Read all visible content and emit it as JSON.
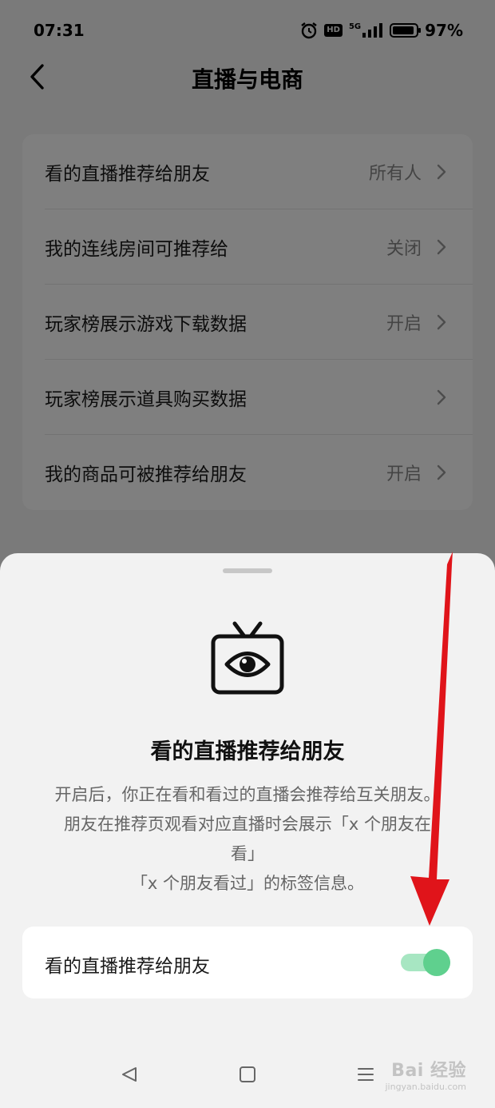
{
  "status_bar": {
    "time": "07:31",
    "hd_label": "HD",
    "network_label": "5G",
    "battery_percent": "97%"
  },
  "header": {
    "title": "直播与电商"
  },
  "settings": [
    {
      "label": "看的直播推荐给朋友",
      "value": "所有人"
    },
    {
      "label": "我的连线房间可推荐给",
      "value": "关闭"
    },
    {
      "label": "玩家榜展示游戏下载数据",
      "value": "开启"
    },
    {
      "label": "玩家榜展示道具购买数据",
      "value": ""
    },
    {
      "label": "我的商品可被推荐给朋友",
      "value": "开启"
    }
  ],
  "sheet": {
    "title": "看的直播推荐给朋友",
    "description_lines": [
      "开启后，你正在看和看过的直播会推荐给互关朋友。",
      "朋友在推荐页观看对应直播时会展示「x 个朋友在",
      "看」",
      "「x 个朋友看过」的标签信息。"
    ],
    "toggle_label": "看的直播推荐给朋友",
    "toggle_on": true
  },
  "watermark": {
    "logo": "Bai 经验",
    "sub": "jingyan.baidu.com"
  },
  "colors": {
    "toggle_on": "#5fd08e",
    "annotation_arrow": "#e0141a"
  }
}
